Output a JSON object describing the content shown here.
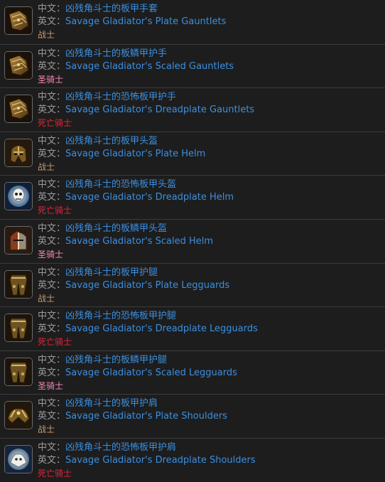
{
  "labels": {
    "cn": "中文：",
    "en": "英文："
  },
  "class_colors": {
    "战士": "#c79c6e",
    "圣骑士": "#f58cba",
    "死亡骑士": "#e6233c"
  },
  "items": [
    {
      "cn": "凶残角斗士的板甲手套",
      "en": "Savage Gladiator's Plate Gauntlets",
      "cls": "战士",
      "icon": "gauntlets-icon"
    },
    {
      "cn": "凶残角斗士的板鳞甲护手",
      "en": "Savage Gladiator's Scaled Gauntlets",
      "cls": "圣骑士",
      "icon": "gauntlets-icon"
    },
    {
      "cn": "凶残角斗士的恐怖板甲护手",
      "en": "Savage Gladiator's Dreadplate Gauntlets",
      "cls": "死亡骑士",
      "icon": "gauntlets-icon"
    },
    {
      "cn": "凶残角斗士的板甲头盔",
      "en": "Savage Gladiator's Plate Helm",
      "cls": "战士",
      "icon": "helm-icon"
    },
    {
      "cn": "凶残角斗士的恐怖板甲头盔",
      "en": "Savage Gladiator's Dreadplate Helm",
      "cls": "死亡骑士",
      "icon": "skull-helm-icon"
    },
    {
      "cn": "凶残角斗士的板鳞甲头盔",
      "en": "Savage Gladiator's Scaled Helm",
      "cls": "圣骑士",
      "icon": "scaled-helm-icon"
    },
    {
      "cn": "凶残角斗士的板甲护腿",
      "en": "Savage Gladiator's Plate Legguards",
      "cls": "战士",
      "icon": "legguards-icon"
    },
    {
      "cn": "凶残角斗士的恐怖板甲护腿",
      "en": "Savage Gladiator's Dreadplate Legguards",
      "cls": "死亡骑士",
      "icon": "legguards-icon"
    },
    {
      "cn": "凶残角斗士的板鳞甲护腿",
      "en": "Savage Gladiator's Scaled Legguards",
      "cls": "圣骑士",
      "icon": "legguards-icon"
    },
    {
      "cn": "凶残角斗士的板甲护肩",
      "en": "Savage Gladiator's Plate Shoulders",
      "cls": "战士",
      "icon": "shoulders-icon"
    },
    {
      "cn": "凶残角斗士的恐怖板甲护肩",
      "en": "Savage Gladiator's Dreadplate Shoulders",
      "cls": "死亡骑士",
      "icon": "skull-shoulders-icon"
    }
  ]
}
